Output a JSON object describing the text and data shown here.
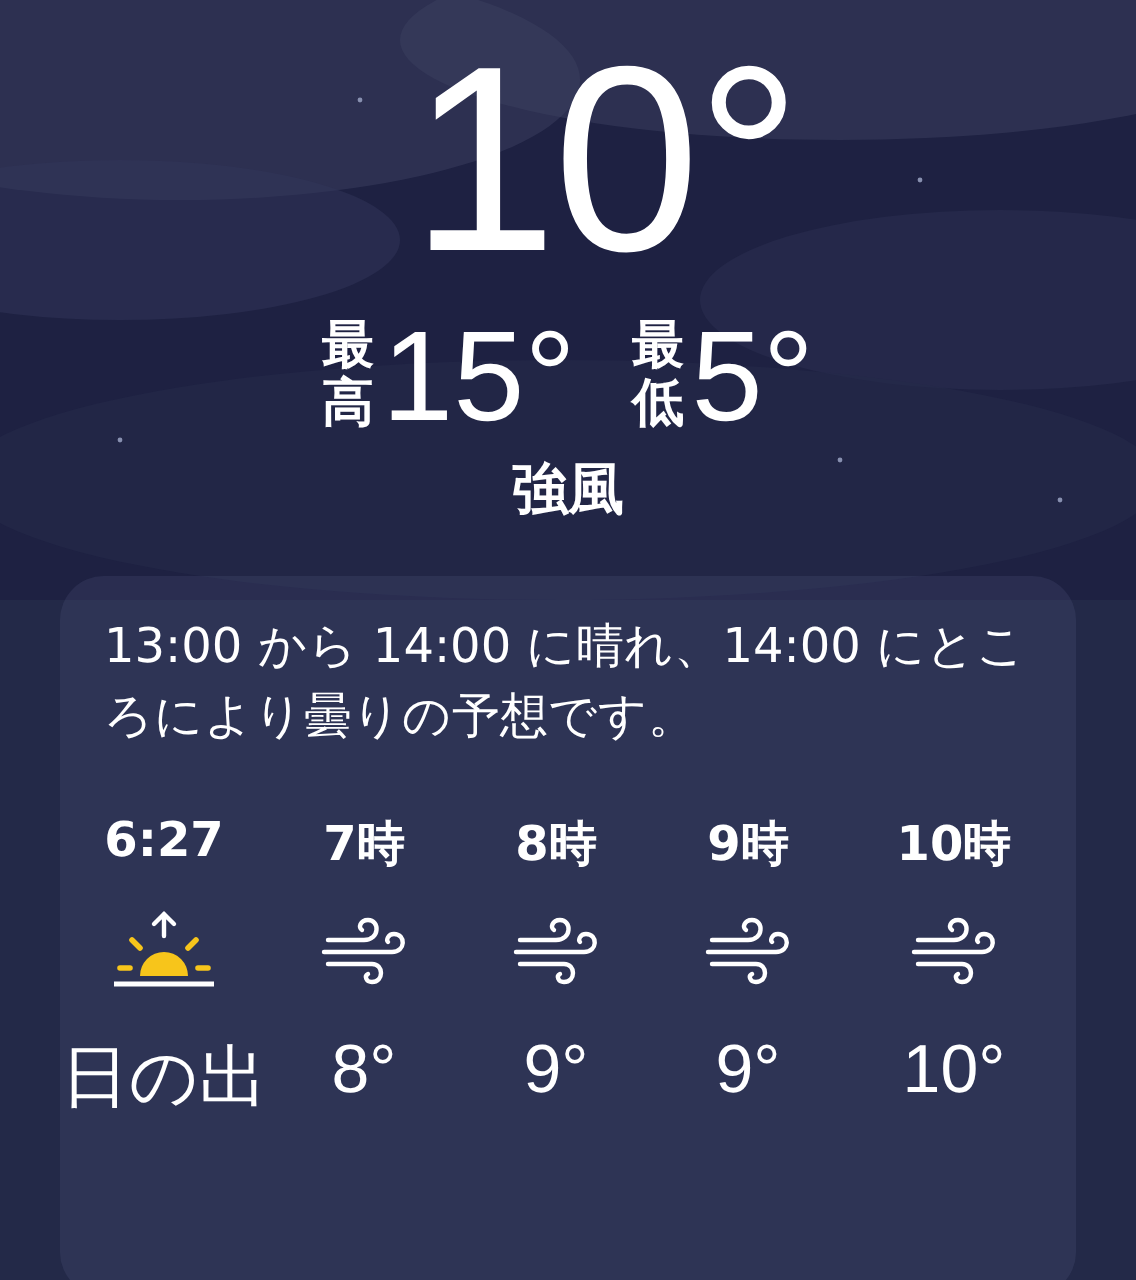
{
  "current": {
    "temperature": "10°"
  },
  "range": {
    "high_label": "最高",
    "high": "15°",
    "low_label": "最低",
    "low": "5°"
  },
  "condition": "強風",
  "forecast": {
    "summary": "13:00 から 14:00 に晴れ、14:00 にところにより曇りの予想です。",
    "hours": [
      {
        "time": "6:27",
        "kind": "sunrise",
        "value": "日の出"
      },
      {
        "time": "7時",
        "kind": "wind",
        "value": "8°"
      },
      {
        "time": "8時",
        "kind": "wind",
        "value": "9°"
      },
      {
        "time": "9時",
        "kind": "wind",
        "value": "9°"
      },
      {
        "time": "10時",
        "kind": "wind",
        "value": "10°"
      }
    ]
  }
}
